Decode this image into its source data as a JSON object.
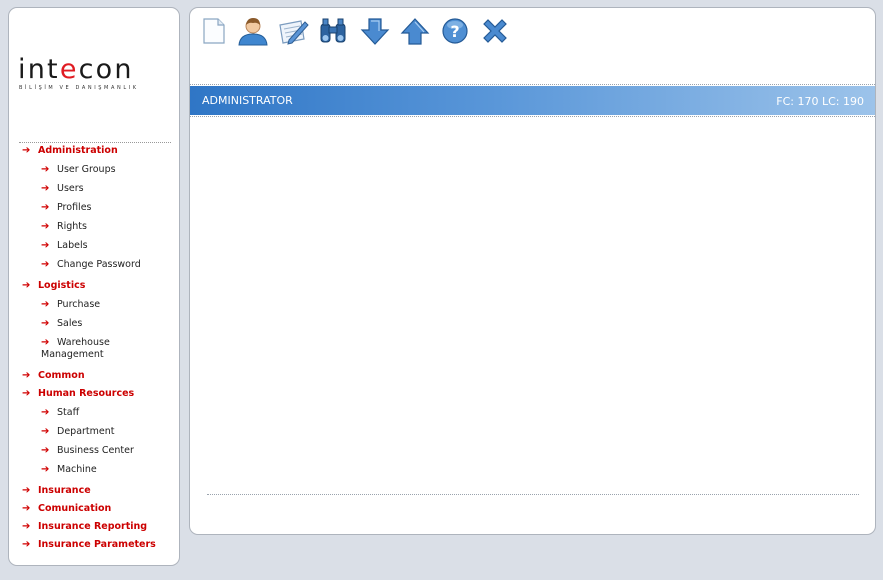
{
  "logo": {
    "word_pre": "int",
    "word_accent": "e",
    "word_post": "con",
    "tagline": "BİLİŞİM VE DANIŞMANLIK"
  },
  "toolbar": {
    "new": "new-document-icon",
    "user": "user-icon",
    "edit": "edit-icon",
    "search": "binoculars-icon",
    "down": "arrow-down-icon",
    "up": "arrow-up-icon",
    "help": "help-icon",
    "close": "close-icon"
  },
  "header": {
    "title": "ADMINISTRATOR",
    "info": "FC: 170 LC: 190"
  },
  "colors": {
    "accent_red": "#cc0000",
    "header_blue": "#2f76c6"
  },
  "menu": [
    {
      "label": "Administration",
      "level": "top"
    },
    {
      "label": "User Groups",
      "level": "sub"
    },
    {
      "label": "Users",
      "level": "sub"
    },
    {
      "label": "Profiles",
      "level": "sub"
    },
    {
      "label": "Rights",
      "level": "sub"
    },
    {
      "label": "Labels",
      "level": "sub"
    },
    {
      "label": "Change Password",
      "level": "sub"
    },
    {
      "label": "Logistics",
      "level": "top"
    },
    {
      "label": "Purchase",
      "level": "sub"
    },
    {
      "label": "Sales",
      "level": "sub"
    },
    {
      "label": "Warehouse Management",
      "level": "sub"
    },
    {
      "label": "Common",
      "level": "top"
    },
    {
      "label": "Human Resources",
      "level": "top"
    },
    {
      "label": "Staff",
      "level": "sub"
    },
    {
      "label": "Department",
      "level": "sub"
    },
    {
      "label": "Business Center",
      "level": "sub"
    },
    {
      "label": "Machine",
      "level": "sub"
    },
    {
      "label": "Insurance",
      "level": "top"
    },
    {
      "label": "Comunication",
      "level": "top"
    },
    {
      "label": "Insurance Reporting",
      "level": "top"
    },
    {
      "label": "Insurance Parameters",
      "level": "top"
    }
  ]
}
